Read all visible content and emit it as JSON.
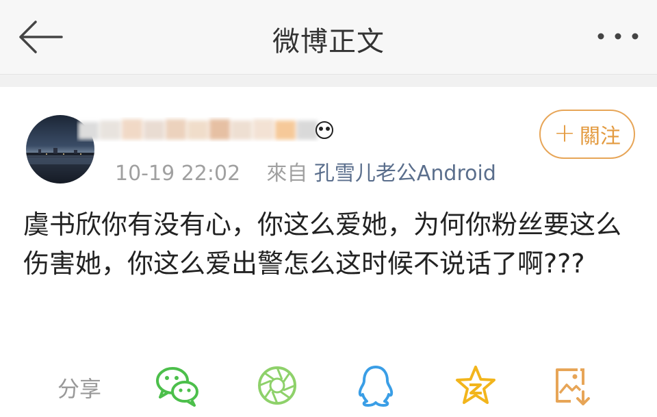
{
  "header": {
    "title": "微博正文"
  },
  "post": {
    "time": "10-19 22:02",
    "via_label": "來自",
    "source": "孔雪儿老公Android",
    "follow_label": "關注",
    "content": "虞书欣你有没有心，你这么爱她，为何你粉丝要这么伤害她，你这么爱出警怎么这时候不说话了啊???"
  },
  "share": {
    "label": "分享",
    "icons": [
      "wechat-icon",
      "moments-icon",
      "qq-icon",
      "qzone-icon",
      "save-image-icon"
    ]
  },
  "colors": {
    "accent_orange": "#e39a3f",
    "link_blue": "#5a6e8c",
    "muted_gray": "#a0a0a0",
    "wechat_green": "#4cbf4b",
    "qq_blue": "#3a9ee6",
    "qzone_yellow": "#f2b51c"
  }
}
